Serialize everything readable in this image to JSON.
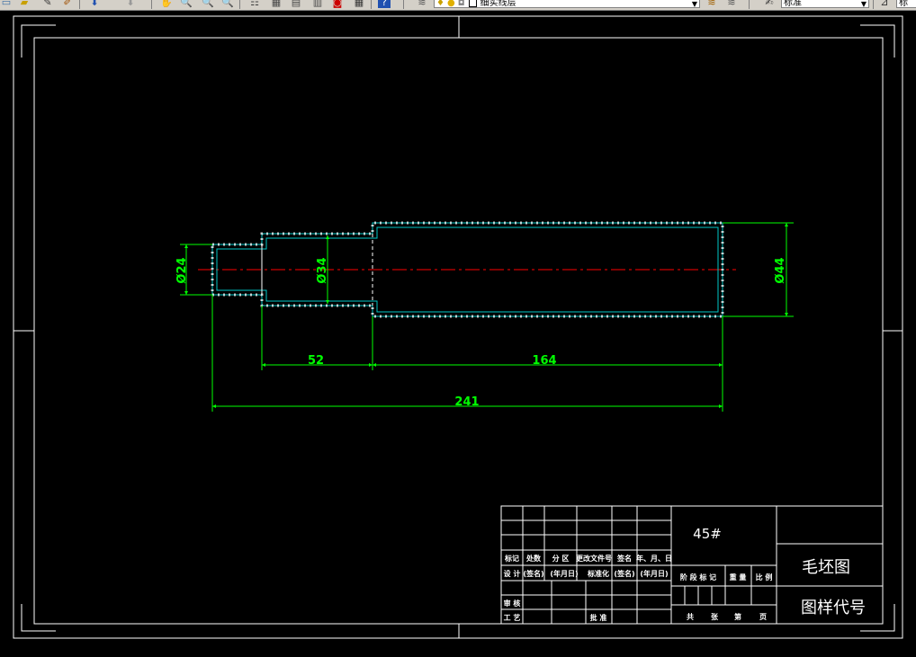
{
  "toolbar": {
    "layer_name": "细实线层",
    "text_style": "标准",
    "dim_style": "标"
  },
  "drawing": {
    "dimensions": {
      "d_small": "Ø24",
      "d_mid": "Ø34",
      "d_large": "Ø44",
      "len_mid": "52",
      "len_large": "164",
      "len_total": "241"
    },
    "title_block": {
      "material": "45#",
      "name": "毛坯图",
      "drawing_code": "图样代号",
      "row1": [
        "标记",
        "处数",
        "分 区",
        "更改文件号",
        "签名",
        "年、月、日"
      ],
      "row2": [
        "设 计",
        "(签名)",
        "(年月日)",
        "标准化",
        "(签名)",
        "(年月日)"
      ],
      "stage_row": [
        "阶 段 标 记",
        "重 量",
        "比 例"
      ],
      "review": "审 核",
      "process": "工 艺",
      "approve": "批 准",
      "sheets": [
        "共",
        "张",
        "第",
        "页"
      ]
    }
  }
}
